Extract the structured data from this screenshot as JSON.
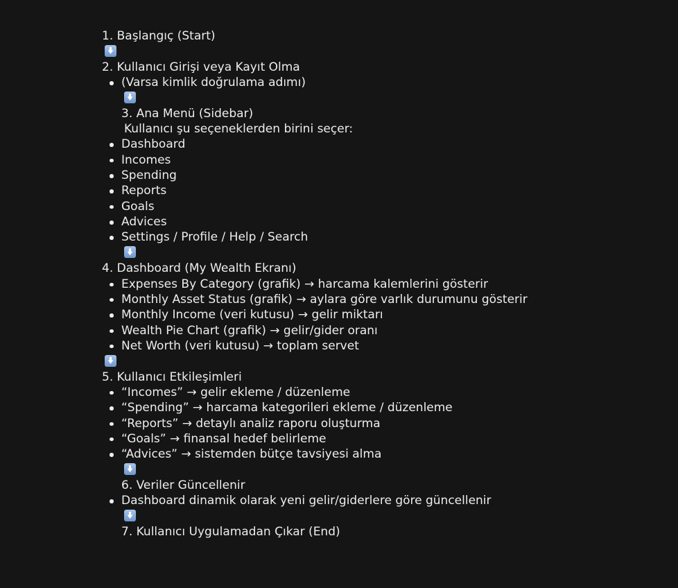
{
  "doc": {
    "step1": "1. Başlangıç (Start)",
    "step2": "2. Kullanıcı Girişi veya Kayıt Olma",
    "step2_note": "(Varsa kimlik doğrulama adımı)",
    "step3": "3. Ana Menü (Sidebar)",
    "step3_sub": "Kullanıcı şu seçeneklerden birini seçer:",
    "menu_items": [
      "Dashboard",
      "Incomes",
      "Spending",
      "Reports",
      "Goals",
      "Advices",
      "Settings / Profile / Help / Search"
    ],
    "step4": "4. Dashboard (My Wealth Ekranı)",
    "dashboard_items": [
      "Expenses By Category (grafik) → harcama kalemlerini gösterir",
      "Monthly Asset Status (grafik) → aylara göre varlık durumunu gösterir",
      "Monthly Income (veri kutusu) → gelir miktarı",
      "Wealth Pie Chart (grafik) → gelir/gider oranı",
      "Net Worth (veri kutusu) → toplam servet"
    ],
    "step5": "5. Kullanıcı Etkileşimleri",
    "interaction_items": [
      "“Incomes” → gelir ekleme / düzenleme",
      "“Spending” → harcama kategorileri ekleme / düzenleme",
      "“Reports” → detaylı analiz raporu oluşturma",
      "“Goals” → finansal hedef belirleme",
      "“Advices” → sistemden bütçe tavsiyesi alma"
    ],
    "step6": "6. Veriler Güncellenir",
    "step6_item": "Dashboard dinamik olarak yeni gelir/giderlere göre güncellenir",
    "step7": "7. Kullanıcı Uygulamadan Çıkar (End)"
  },
  "icons": {
    "arrow": "down-arrow-emoji",
    "arrow_color": "#7ea3d8"
  },
  "colors": {
    "background": "#151515",
    "text": "#ededed"
  }
}
